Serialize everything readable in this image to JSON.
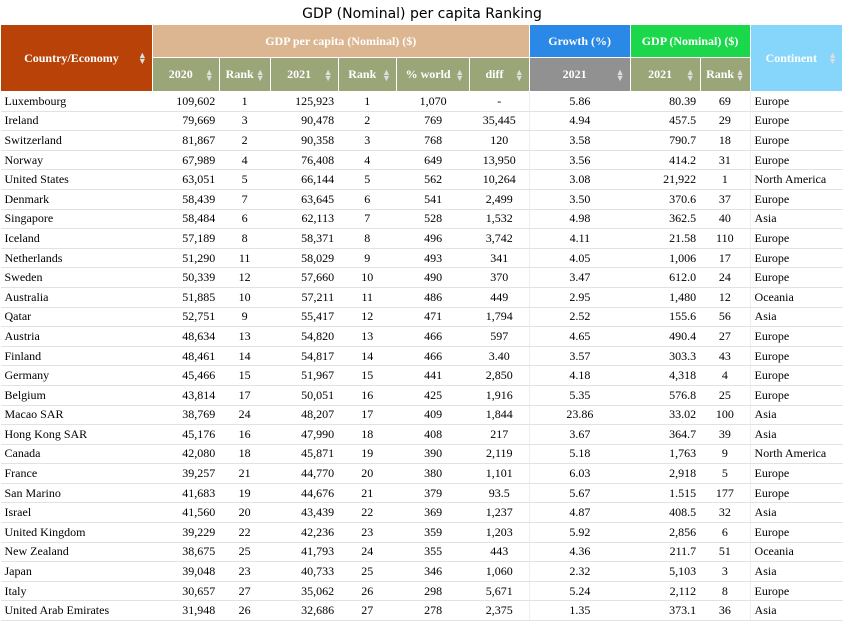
{
  "chart_data": {
    "type": "table",
    "title": "GDP (Nominal) per capita Ranking",
    "headers": {
      "country": "Country/Economy",
      "gdp_per_capita": "GDP per capita (Nominal) ($)",
      "growth": "Growth (%)",
      "gdp_nominal": "GDP (Nominal) ($)",
      "continent": "Continent",
      "sub": [
        "2020",
        "Rank",
        "2021",
        "Rank",
        "% world",
        "diff",
        "2021",
        "2021",
        "Rank"
      ]
    },
    "rows": [
      [
        "Luxembourg",
        "109,602",
        "1",
        "125,923",
        "1",
        "1,070",
        "-",
        "5.86",
        "80.39",
        "69",
        "Europe"
      ],
      [
        "Ireland",
        "79,669",
        "3",
        "90,478",
        "2",
        "769",
        "35,445",
        "4.94",
        "457.5",
        "29",
        "Europe"
      ],
      [
        "Switzerland",
        "81,867",
        "2",
        "90,358",
        "3",
        "768",
        "120",
        "3.58",
        "790.7",
        "18",
        "Europe"
      ],
      [
        "Norway",
        "67,989",
        "4",
        "76,408",
        "4",
        "649",
        "13,950",
        "3.56",
        "414.2",
        "31",
        "Europe"
      ],
      [
        "United States",
        "63,051",
        "5",
        "66,144",
        "5",
        "562",
        "10,264",
        "3.08",
        "21,922",
        "1",
        "North America"
      ],
      [
        "Denmark",
        "58,439",
        "7",
        "63,645",
        "6",
        "541",
        "2,499",
        "3.50",
        "370.6",
        "37",
        "Europe"
      ],
      [
        "Singapore",
        "58,484",
        "6",
        "62,113",
        "7",
        "528",
        "1,532",
        "4.98",
        "362.5",
        "40",
        "Asia"
      ],
      [
        "Iceland",
        "57,189",
        "8",
        "58,371",
        "8",
        "496",
        "3,742",
        "4.11",
        "21.58",
        "110",
        "Europe"
      ],
      [
        "Netherlands",
        "51,290",
        "11",
        "58,029",
        "9",
        "493",
        "341",
        "4.05",
        "1,006",
        "17",
        "Europe"
      ],
      [
        "Sweden",
        "50,339",
        "12",
        "57,660",
        "10",
        "490",
        "370",
        "3.47",
        "612.0",
        "24",
        "Europe"
      ],
      [
        "Australia",
        "51,885",
        "10",
        "57,211",
        "11",
        "486",
        "449",
        "2.95",
        "1,480",
        "12",
        "Oceania"
      ],
      [
        "Qatar",
        "52,751",
        "9",
        "55,417",
        "12",
        "471",
        "1,794",
        "2.52",
        "155.6",
        "56",
        "Asia"
      ],
      [
        "Austria",
        "48,634",
        "13",
        "54,820",
        "13",
        "466",
        "597",
        "4.65",
        "490.4",
        "27",
        "Europe"
      ],
      [
        "Finland",
        "48,461",
        "14",
        "54,817",
        "14",
        "466",
        "3.40",
        "3.57",
        "303.3",
        "43",
        "Europe"
      ],
      [
        "Germany",
        "45,466",
        "15",
        "51,967",
        "15",
        "441",
        "2,850",
        "4.18",
        "4,318",
        "4",
        "Europe"
      ],
      [
        "Belgium",
        "43,814",
        "17",
        "50,051",
        "16",
        "425",
        "1,916",
        "5.35",
        "576.8",
        "25",
        "Europe"
      ],
      [
        "Macao SAR",
        "38,769",
        "24",
        "48,207",
        "17",
        "409",
        "1,844",
        "23.86",
        "33.02",
        "100",
        "Asia"
      ],
      [
        "Hong Kong SAR",
        "45,176",
        "16",
        "47,990",
        "18",
        "408",
        "217",
        "3.67",
        "364.7",
        "39",
        "Asia"
      ],
      [
        "Canada",
        "42,080",
        "18",
        "45,871",
        "19",
        "390",
        "2,119",
        "5.18",
        "1,763",
        "9",
        "North America"
      ],
      [
        "France",
        "39,257",
        "21",
        "44,770",
        "20",
        "380",
        "1,101",
        "6.03",
        "2,918",
        "5",
        "Europe"
      ],
      [
        "San Marino",
        "41,683",
        "19",
        "44,676",
        "21",
        "379",
        "93.5",
        "5.67",
        "1.515",
        "177",
        "Europe"
      ],
      [
        "Israel",
        "41,560",
        "20",
        "43,439",
        "22",
        "369",
        "1,237",
        "4.87",
        "408.5",
        "32",
        "Asia"
      ],
      [
        "United Kingdom",
        "39,229",
        "22",
        "42,236",
        "23",
        "359",
        "1,203",
        "5.92",
        "2,856",
        "6",
        "Europe"
      ],
      [
        "New Zealand",
        "38,675",
        "25",
        "41,793",
        "24",
        "355",
        "443",
        "4.36",
        "211.7",
        "51",
        "Oceania"
      ],
      [
        "Japan",
        "39,048",
        "23",
        "40,733",
        "25",
        "346",
        "1,060",
        "2.32",
        "5,103",
        "3",
        "Asia"
      ],
      [
        "Italy",
        "30,657",
        "27",
        "35,062",
        "26",
        "298",
        "5,671",
        "5.24",
        "2,112",
        "8",
        "Europe"
      ],
      [
        "United Arab Emirates",
        "31,948",
        "26",
        "32,686",
        "27",
        "278",
        "2,375",
        "1.35",
        "373.1",
        "36",
        "Asia"
      ]
    ]
  },
  "sort_glyphs": {
    "up": "▲",
    "down": "▼"
  },
  "colors": {
    "country_header": "#b84208",
    "gdp_header": "#dbb690",
    "gdp_sub_header": "#9aa578",
    "growth_header": "#2a88e6",
    "growth_sub_header": "#919191",
    "gdp_nominal_header": "#1bd74a",
    "continent_header": "#86d6fb"
  }
}
